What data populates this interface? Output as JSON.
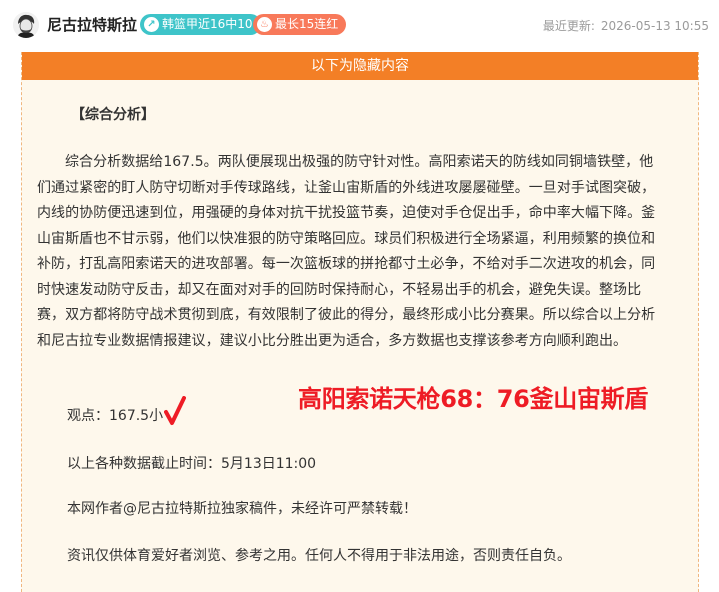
{
  "header": {
    "author": "尼古拉特斯拉",
    "badges": [
      {
        "label": "韩篮甲近16中10",
        "icon": "trend-icon",
        "color": "#3ec4c9"
      },
      {
        "label": "最长15连红",
        "icon": "flame-icon",
        "color": "#f8795a"
      }
    ],
    "update_label": "最近更新:",
    "update_time": "2026-05-13 10:55"
  },
  "content": {
    "hidden_banner": "以下为隐藏内容",
    "section_title": "【综合分析】",
    "analysis": "综合分析数据给167.5。两队便展现出极强的防守针对性。高阳索诺天的防线如同铜墙铁壁，他们通过紧密的盯人防守切断对手传球路线，让釜山宙斯盾的外线进攻屡屡碰壁。一旦对手试图突破，内线的协防便迅速到位，用强硬的身体对抗干扰投篮节奏，迫使对手仓促出手，命中率大幅下降。釜山宙斯盾也不甘示弱，他们以快准狠的防守策略回应。球员们积极进行全场紧逼，利用频繁的换位和补防，打乱高阳索诺天的进攻部署。每一次篮板球的拼抢都寸土必争，不给对手二次进攻的机会，同时快速发动防守反击，却又在面对对手的回防时保持耐心，不轻易出手的机会，避免失误。整场比赛，双方都将防守战术贯彻到底，有效限制了彼此的得分，最终形成小比分赛果。所以综合以上分析和尼古拉专业数据情报建议，建议小比分胜出更为适合，多方数据也支撑该参考方向顺利跑出。",
    "view": "观点：167.5小",
    "score": "高阳索诺天枪68：76釜山宙斯盾",
    "cutoff": "以上各种数据截止时间：5月13日11:00",
    "copyright": "本网作者@尼古拉特斯拉独家稿件，未经许可严禁转载！",
    "disclaimer": "资讯仅供体育爱好者浏览、参考之用。任何人不得用于非法用途，否则责任自负。"
  },
  "colors": {
    "accent_orange": "#f37f26",
    "panel_bg": "#fef8ec",
    "score_red": "#ee1c25"
  }
}
